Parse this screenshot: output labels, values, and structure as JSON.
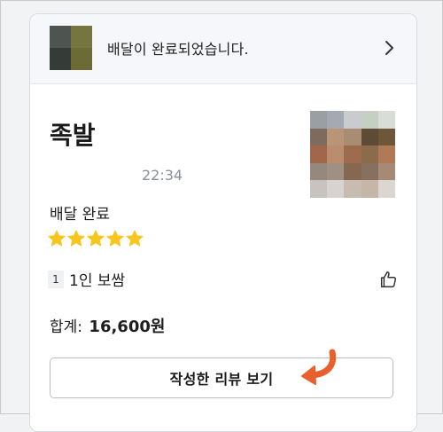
{
  "banner": {
    "text": "배달이 완료되었습니다.",
    "thumb_colors": [
      "#4e5550",
      "#74753f",
      "#353b36",
      "#6c6b36"
    ]
  },
  "order": {
    "restaurant": "족발",
    "time": "22:34",
    "status": "배달 완료",
    "rating": 5,
    "item_qty": "1",
    "item_name": "1인 보쌈",
    "total_label": "합계:",
    "total_amount": "16,600원"
  },
  "food_thumb_colors": [
    "#9a9fa3",
    "#a5aab2",
    "#c9cbcf",
    "#c6cfc4",
    "#d9ddd7",
    "#7f6a5f",
    "#b89577",
    "#a98d73",
    "#5f4a36",
    "#6d5738",
    "#a0674a",
    "#b98d6d",
    "#9d6c4f",
    "#8a6b4c",
    "#b07a57",
    "#94887f",
    "#a08f83",
    "#866750",
    "#86705f",
    "#a68a76",
    "#c9c3bf",
    "#d8d3d0",
    "#c8bcb1",
    "#c5b6a8",
    "#dcd6d1"
  ],
  "review_button": {
    "label": "작성한 리뷰 보기"
  },
  "colors": {
    "star": "#f8c51d",
    "arrow": "#e8602c"
  }
}
